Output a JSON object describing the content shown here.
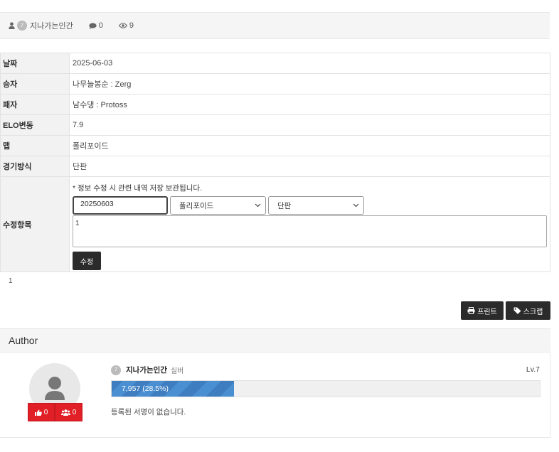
{
  "post": {
    "title_partial": "—",
    "author_name": "지나가는인간",
    "author_level_badge": "7",
    "comment_count": "0",
    "view_count": "9"
  },
  "fields": [
    {
      "label": "날짜",
      "value": "2025-06-03"
    },
    {
      "label": "승자",
      "value": "나무늘봉순 : Zerg"
    },
    {
      "label": "패자",
      "value": "남수댕 : Protoss"
    },
    {
      "label": "ELO변동",
      "value": "7.9"
    },
    {
      "label": "맵",
      "value": "폴리포이드"
    },
    {
      "label": "경기방식",
      "value": "단판"
    }
  ],
  "edit": {
    "label": "수정항목",
    "notice": "* 정보 수정 시 관련 내역 저장 보관됩니다.",
    "date_value": "20250603",
    "map_selected": "폴리포이드",
    "mode_selected": "단판",
    "textarea_value": "1",
    "submit_label": "수정"
  },
  "below_count": "1",
  "buttons": {
    "print": "프린트",
    "scrap": "스크랩"
  },
  "author": {
    "section_title": "Author",
    "badge": "7",
    "nickname": "지나가는인간",
    "grade": "실버",
    "level": "Lv.7",
    "exp_text": "7,957 (28.5%)",
    "exp_percent": 28.5,
    "likes": "0",
    "friends": "0",
    "signature": "등록된 서명이 없습니다."
  },
  "colors": {
    "accent_red": "#e01f26",
    "exp_blue": "#4a8fd1",
    "dark_button": "#2b2b2b"
  }
}
